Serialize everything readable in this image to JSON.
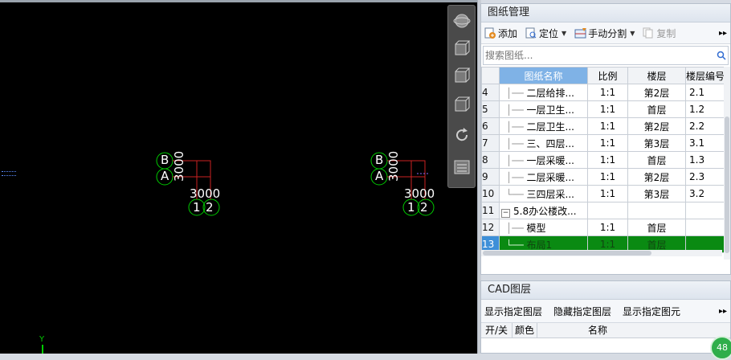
{
  "drawing_panel": {
    "title": "图纸管理",
    "toolbar": {
      "add": "添加",
      "locate": "定位",
      "manual_split": "手动分割",
      "copy": "复制"
    },
    "search_placeholder": "搜索图纸...",
    "columns": [
      "",
      "图纸名称",
      "比例",
      "楼层",
      "楼层编号"
    ],
    "rows": [
      {
        "num": "4",
        "name": "二层给排...",
        "scale": "1:1",
        "floor": "第2层",
        "floor_no": "2.1"
      },
      {
        "num": "5",
        "name": "一层卫生...",
        "scale": "1:1",
        "floor": "首层",
        "floor_no": "1.2"
      },
      {
        "num": "6",
        "name": "二层卫生...",
        "scale": "1:1",
        "floor": "第2层",
        "floor_no": "2.2"
      },
      {
        "num": "7",
        "name": "三、四层...",
        "scale": "1:1",
        "floor": "第3层",
        "floor_no": "3.1"
      },
      {
        "num": "8",
        "name": "一层采暖...",
        "scale": "1:1",
        "floor": "首层",
        "floor_no": "1.3"
      },
      {
        "num": "9",
        "name": "二层采暖...",
        "scale": "1:1",
        "floor": "第2层",
        "floor_no": "2.3"
      },
      {
        "num": "10",
        "name": "三四层采...",
        "scale": "1:1",
        "floor": "第3层",
        "floor_no": "3.2"
      },
      {
        "num": "11",
        "name": "5.8办公楼改...",
        "scale": "",
        "floor": "",
        "floor_no": ""
      },
      {
        "num": "12",
        "name": "模型",
        "scale": "1:1",
        "floor": "首层",
        "floor_no": ""
      },
      {
        "num": "13",
        "name": "布局1",
        "scale": "1:1",
        "floor": "首层",
        "floor_no": ""
      }
    ],
    "selected_row": "13"
  },
  "cad_panel": {
    "title": "CAD图层",
    "links": [
      "显示指定图层",
      "隐藏指定图层",
      "显示指定图元"
    ],
    "columns": [
      "开/关",
      "颜色",
      "名称"
    ]
  },
  "canvas": {
    "left_group": {
      "top_label": "B",
      "bottom_label": "A",
      "vertical_dim": "3000",
      "horizontal_dim": "3000",
      "axis_left": "1",
      "axis_right": "2"
    },
    "right_group": {
      "top_label": "B",
      "bottom_label": "A",
      "vertical_dim": "3000",
      "horizontal_dim": "3000",
      "axis_left": "1",
      "axis_right": "2"
    },
    "y_axis_label": "Y",
    "badge": "48"
  },
  "colors": {
    "canvas_bg": "#000000",
    "bubble": "#00cc00",
    "grid_line": "#cc2222",
    "selected_row": "#0a8a12",
    "header_highlight": "#7fb2e6"
  }
}
